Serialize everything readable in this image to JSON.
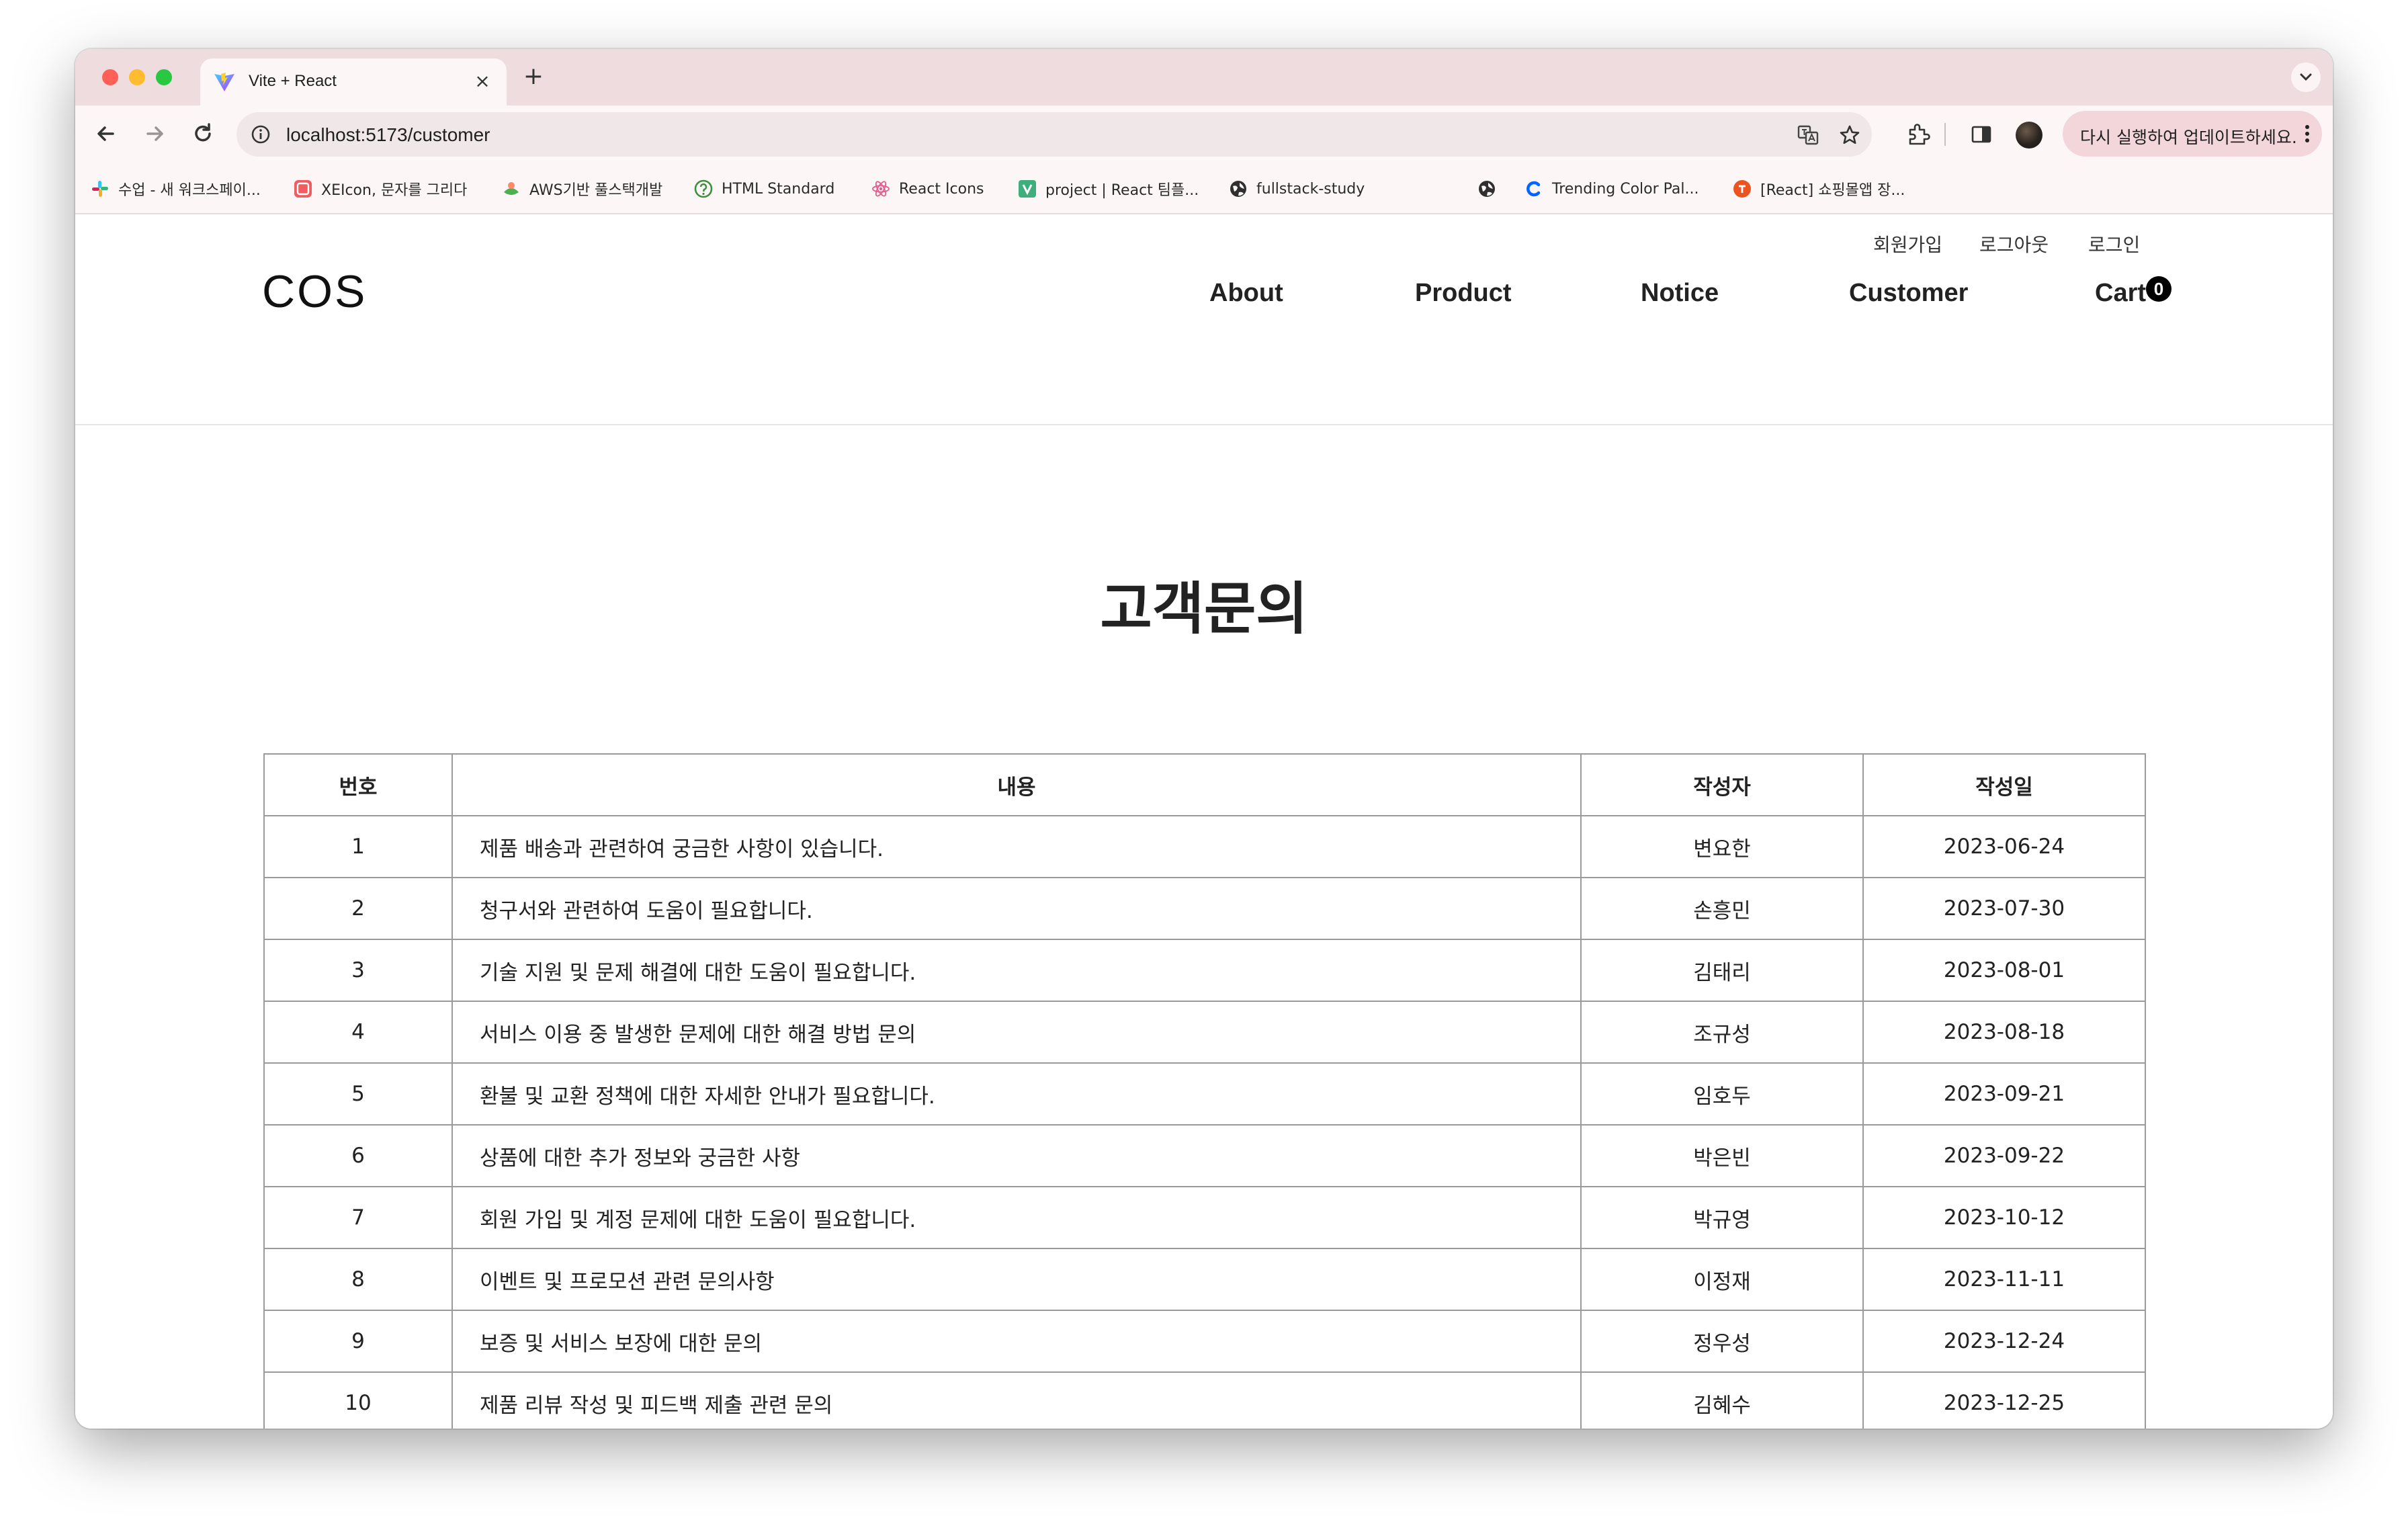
{
  "browser": {
    "tab_title": "Vite + React",
    "tab_close": "×",
    "new_tab": "+",
    "url": "localhost:5173/customer",
    "update_button": "다시 실행하여 업데이트하세요.",
    "bookmarks": [
      {
        "label": "수업 - 새 워크스페이...",
        "icon": "slack-icon"
      },
      {
        "label": "XEIcon, 문자를 그리다",
        "icon": "xeicon-icon"
      },
      {
        "label": "AWS기반 풀스택개발",
        "icon": "leaf-icon"
      },
      {
        "label": "HTML Standard",
        "icon": "html-standard-icon"
      },
      {
        "label": "React Icons",
        "icon": "react-icon"
      },
      {
        "label": "project | React 팀플...",
        "icon": "vuepress-icon"
      },
      {
        "label": "fullstack-study",
        "icon": "globe-icon"
      },
      {
        "label": "",
        "icon": "globe-icon"
      },
      {
        "label": "Trending Color Pal...",
        "icon": "coolors-icon"
      },
      {
        "label": "[React] 쇼핑몰앱 장...",
        "icon": "tistory-icon"
      }
    ]
  },
  "header": {
    "logo": "COS",
    "util_links": [
      "회원가입",
      "로그아웃",
      "로그인"
    ],
    "nav": [
      "About",
      "Product",
      "Notice",
      "Customer",
      "Cart"
    ],
    "cart_count": "0"
  },
  "main": {
    "title": "고객문의",
    "table": {
      "columns": [
        "번호",
        "내용",
        "작성자",
        "작성일"
      ],
      "rows": [
        [
          "1",
          "제품 배송과 관련하여 궁금한 사항이 있습니다.",
          "변요한",
          "2023-06-24"
        ],
        [
          "2",
          "청구서와 관련하여 도움이 필요합니다.",
          "손흥민",
          "2023-07-30"
        ],
        [
          "3",
          "기술 지원 및 문제 해결에 대한 도움이 필요합니다.",
          "김태리",
          "2023-08-01"
        ],
        [
          "4",
          "서비스 이용 중 발생한 문제에 대한 해결 방법 문의",
          "조규성",
          "2023-08-18"
        ],
        [
          "5",
          "환불 및 교환 정책에 대한 자세한 안내가 필요합니다.",
          "임호두",
          "2023-09-21"
        ],
        [
          "6",
          "상품에 대한 추가 정보와 궁금한 사항",
          "박은빈",
          "2023-09-22"
        ],
        [
          "7",
          "회원 가입 및 계정 문제에 대한 도움이 필요합니다.",
          "박규영",
          "2023-10-12"
        ],
        [
          "8",
          "이벤트 및 프로모션 관련 문의사항",
          "이정재",
          "2023-11-11"
        ],
        [
          "9",
          "보증 및 서비스 보장에 대한 문의",
          "정우성",
          "2023-12-24"
        ],
        [
          "10",
          "제품 리뷰 작성 및 피드백 제출 관련 문의",
          "김혜수",
          "2023-12-25"
        ]
      ]
    }
  }
}
